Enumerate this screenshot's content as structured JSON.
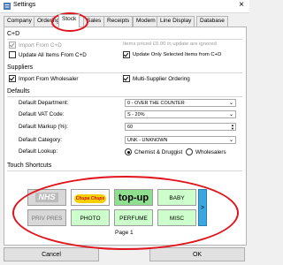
{
  "window": {
    "title": "Settings"
  },
  "tabs": [
    "Company",
    "Ordering",
    "Stock",
    "Sales",
    "Receipts",
    "Modem",
    "Line Display",
    "Database"
  ],
  "active_tab": "Stock",
  "cd": {
    "title": "C+D",
    "import_from_cd": "Import From C+D",
    "items_priced_note": "Items priced £0.00 in update are ignored",
    "update_all_items": "Update All Items From C+D",
    "update_selected_items": "Update Only Selected Items from C+D"
  },
  "suppliers": {
    "title": "Suppliers",
    "import_from_wholesaler": "Import From Wholesaler",
    "multi_supplier_ordering": "Multi-Supplier Ordering"
  },
  "defaults": {
    "title": "Defaults",
    "department_label": "Default Department:",
    "department_value": "0 - OVER THE COUNTER",
    "vat_label": "Default VAT Code:",
    "vat_value": "S - 20%",
    "markup_label": "Default Markup (%):",
    "markup_value": "60",
    "category_label": "Default Category:",
    "category_value": "UNK - UNKNOWN",
    "lookup_label": "Default Lookup:",
    "lookup_chemist": "Chemist & Druggist",
    "lookup_wholesalers": "Wholesalers"
  },
  "shortcuts": {
    "title": "Touch Shortcuts",
    "row1": [
      "NHS",
      "Chupa Chups",
      "top-up",
      "BABY"
    ],
    "row2": [
      "PRIV PRES",
      "PHOTO",
      "PERFUME",
      "MISC"
    ],
    "next_label": ">",
    "page_label": "Page 1"
  },
  "footer": {
    "cancel": "Cancel",
    "ok": "OK"
  },
  "colors": {
    "annotation": "#e0141c",
    "shortcut_green": "#ccffcc",
    "next_blue": "#3aa7e0"
  }
}
